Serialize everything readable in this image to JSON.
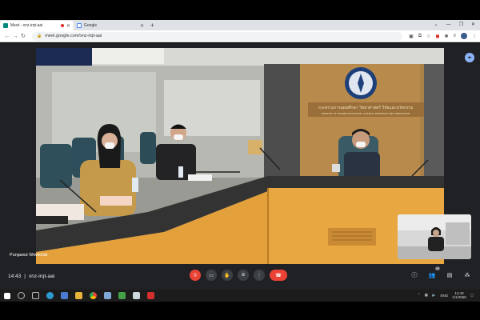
{
  "browser": {
    "tabs": [
      {
        "title": "Meet - xnz-irqt-aai",
        "active": true,
        "icon": "meet-icon"
      },
      {
        "title": "Google",
        "active": false,
        "icon": "google-icon"
      }
    ],
    "url": "meet.google.com/xnz-irqt-aai"
  },
  "meet": {
    "participant_name": "Punjawut Wiwitchai",
    "time": "14:43",
    "meeting_code": "xnz-irqt-aai",
    "participants_count": "40",
    "scene": {
      "sign_line1": "กระทรวงการอุดมศึกษา วิทยาศาสตร์ วิจัยและนวัตกรรม",
      "sign_line2": "MINISTRY OF HIGHER EDUCATION, SCIENCE, RESEARCH AND INNOVATION"
    }
  },
  "taskbar": {
    "lang": "ENG",
    "clock_time": "14:43",
    "clock_date": "1/1/2565"
  },
  "colors": {
    "meet_bg": "#202124",
    "end_call": "#ea4335",
    "mic_off": "#ea4335"
  }
}
